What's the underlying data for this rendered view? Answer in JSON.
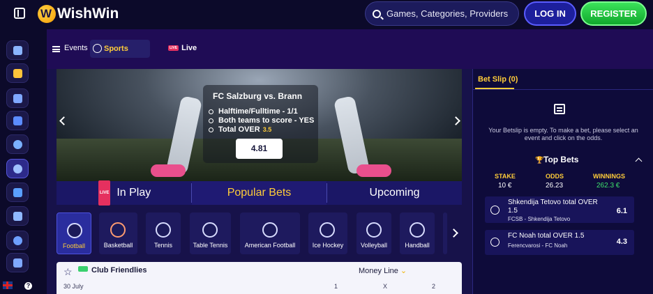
{
  "header": {
    "logo_text": "WishWin",
    "search_placeholder": "Games, Categories, Providers",
    "login_label": "LOG IN",
    "register_label": "REGISTER"
  },
  "sidenav": {
    "items": [
      "gift-icon",
      "home-icon",
      "slots-icon",
      "cards-icon",
      "clover-icon",
      "sports-icon",
      "tv-icon",
      "trophy-icon",
      "swirl-icon",
      "briefcase-icon"
    ],
    "language": "flag-uk-icon",
    "help": "?"
  },
  "menubar": {
    "events_label": "Events",
    "sports_label": "Sports",
    "live_badge": "LIVE",
    "live_label": "Live"
  },
  "hero": {
    "match": "FC Salzburg  vs.  Brann",
    "picks": [
      {
        "text": "Halftime/Fulltime - 1/1",
        "highlight": ""
      },
      {
        "text": "Both teams to score - YES",
        "highlight": ""
      },
      {
        "text": "Total OVER",
        "highlight": "3.5"
      }
    ],
    "odds": "4.81"
  },
  "bet_tabs": {
    "live_badge": "LIVE",
    "in_play": "In Play",
    "popular": "Popular Bets",
    "upcoming": "Upcoming"
  },
  "sports": [
    {
      "label": "Football",
      "icon": "football-icon"
    },
    {
      "label": "Basketball",
      "icon": "basketball-icon"
    },
    {
      "label": "Tennis",
      "icon": "tennis-icon"
    },
    {
      "label": "Table Tennis",
      "icon": "table-tennis-icon"
    },
    {
      "label": "American Football",
      "icon": "american-football-icon"
    },
    {
      "label": "Ice Hockey",
      "icon": "ice-hockey-icon"
    },
    {
      "label": "Volleyball",
      "icon": "volleyball-icon"
    },
    {
      "label": "Handball",
      "icon": "handball-icon"
    }
  ],
  "events": {
    "league": "Club Friendlies",
    "market": "Money Line",
    "date": "30 July",
    "cols": [
      "1",
      "X",
      "2"
    ]
  },
  "betslip": {
    "tab": "Bet Slip (0)",
    "empty_text": "Your Betslip is empty. To make a bet, please select an event and click on the odds.",
    "top_bets_title": "Top Bets",
    "stake_label": "STAKE",
    "odds_label": "ODDS",
    "winnings_label": "WINNINGS",
    "stake": "10 €",
    "odds": "26.23",
    "winnings": "262.3 €",
    "items": [
      {
        "name": "Shkendija Tetovo total OVER 1.5",
        "sub": "FCSB - Shkendija Tetovo",
        "odd": "6.1"
      },
      {
        "name": "FC Noah total OVER 1.5",
        "sub": "Ferencvarosi - FC Noah",
        "odd": "4.3"
      }
    ]
  },
  "colors": {
    "accent": "#ffcd39",
    "background": "#0c0a2a",
    "register": "#1fc540",
    "login": "#1d1f9c"
  }
}
